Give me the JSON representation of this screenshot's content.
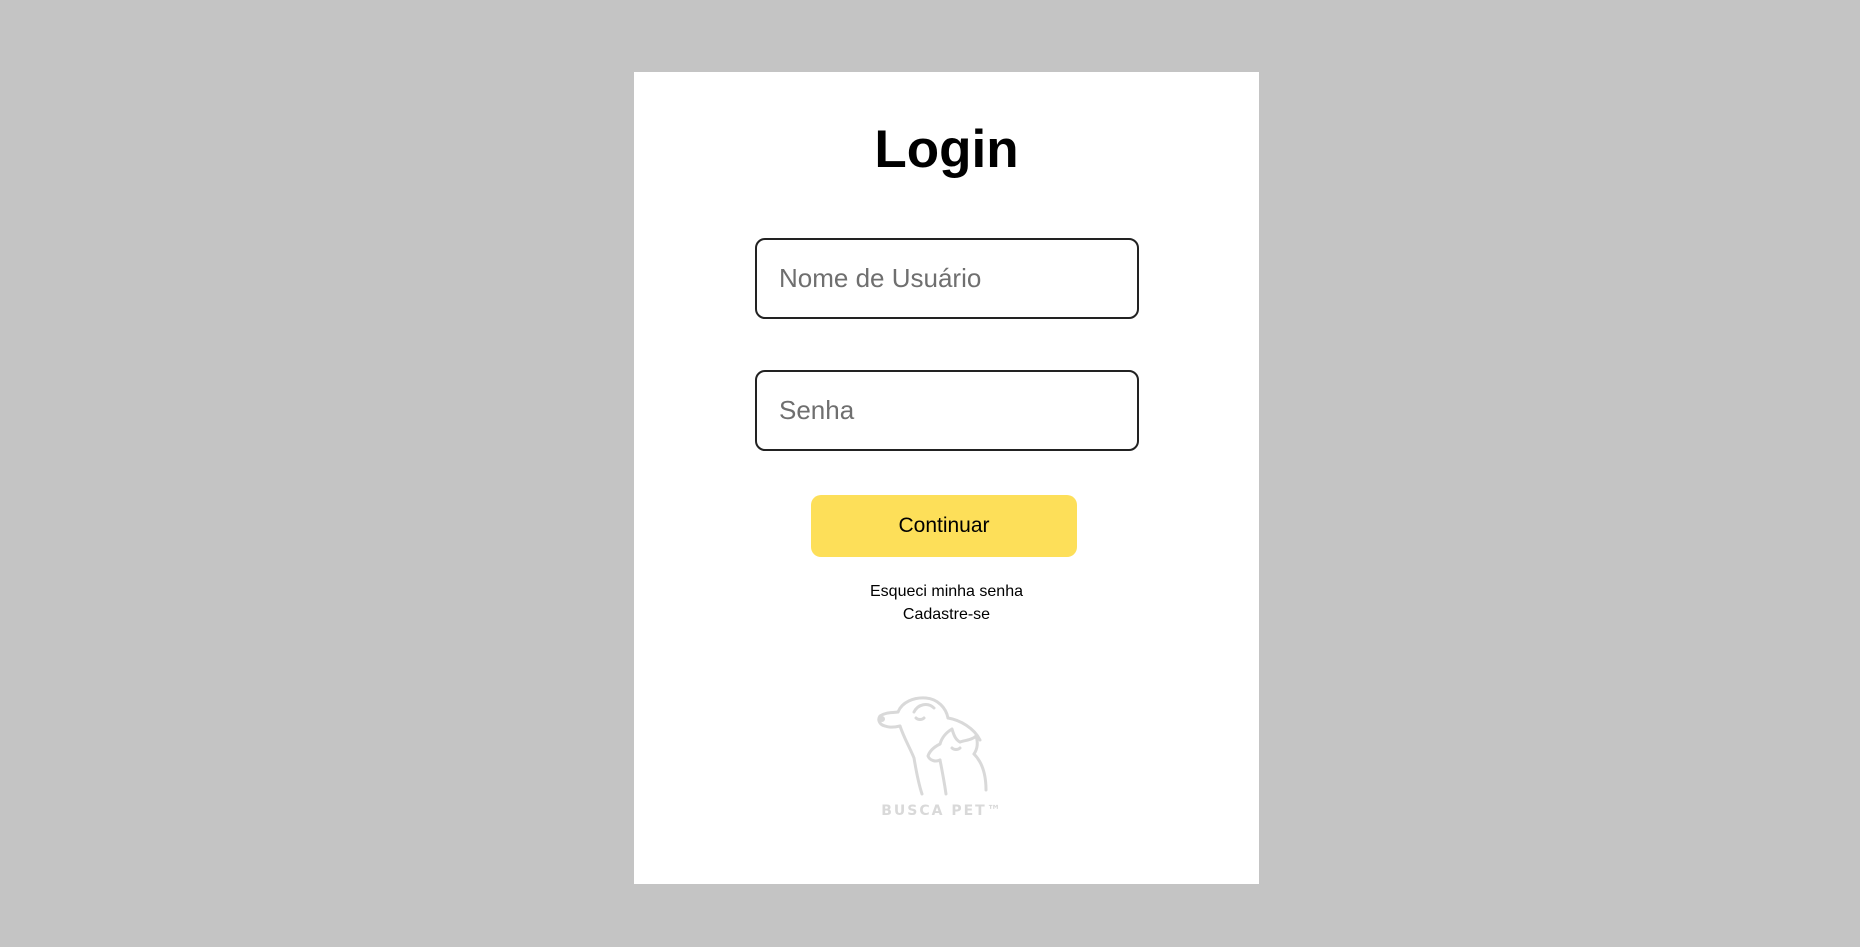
{
  "login": {
    "title": "Login",
    "username_placeholder": "Nome de Usuário",
    "password_placeholder": "Senha",
    "continue_label": "Continuar",
    "forgot_password_label": "Esqueci minha senha",
    "signup_label": "Cadastre-se",
    "logo_text": "BUSCA PET™"
  },
  "colors": {
    "page_background": "#c4c4c4",
    "card_background": "#ffffff",
    "button_accent": "#fddf59",
    "logo_gray": "#d9d9d9"
  }
}
